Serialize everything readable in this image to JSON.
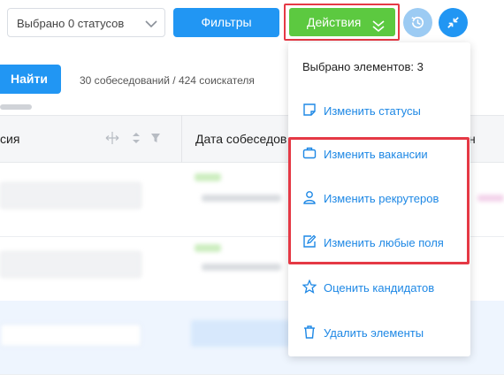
{
  "toolbar": {
    "status_select_value": "Выбрано 0 статусов",
    "filters_label": "Фильтры",
    "actions_label": "Действия"
  },
  "search": {
    "find_label": "Найти",
    "counts_text": "30 собеседований / 424 соискателя"
  },
  "table": {
    "columns": [
      "сия",
      "Дата собеседов",
      "н"
    ]
  },
  "actions_menu": {
    "selected_text": "Выбрано элементов: 3",
    "items": [
      {
        "label": "Изменить статусы",
        "icon": "status-edit-icon"
      },
      {
        "label": "Изменить вакансии",
        "icon": "briefcase-icon"
      },
      {
        "label": "Изменить рекрутеров",
        "icon": "person-icon"
      },
      {
        "label": "Изменить любые поля",
        "icon": "edit-fields-icon"
      },
      {
        "label": "Оценить кандидатов",
        "icon": "star-icon"
      },
      {
        "label": "Удалить элементы",
        "icon": "trash-icon"
      }
    ]
  },
  "colors": {
    "primary": "#2196f3",
    "actions_green": "#5cc940",
    "highlight_red": "#e53945",
    "menu_text": "#1e88e5"
  }
}
